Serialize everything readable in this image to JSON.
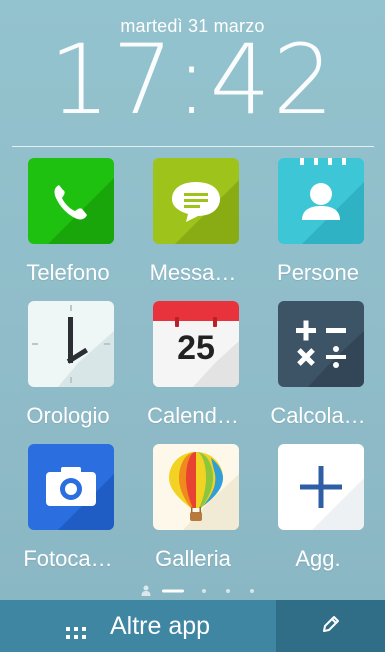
{
  "lockscreen": {
    "date": "martedì 31 marzo",
    "time": "17:42"
  },
  "apps": [
    {
      "label": "Telefono",
      "icon": "phone-icon",
      "color": "#1ec10f"
    },
    {
      "label": "Messa…",
      "icon": "message-icon",
      "color": "#9ec31b"
    },
    {
      "label": "Persone",
      "icon": "contact-icon",
      "color": "#3cc6d6"
    },
    {
      "label": "Orologio",
      "icon": "clock-icon",
      "color": "#eef6f6"
    },
    {
      "label": "Calend…",
      "icon": "calendar-icon",
      "color": "#e8323c",
      "calendar_day": "25"
    },
    {
      "label": "Calcola…",
      "icon": "calculator-icon",
      "color": "#3d5366"
    },
    {
      "label": "Fotoca…",
      "icon": "camera-icon",
      "color": "#2a6ee0"
    },
    {
      "label": "Galleria",
      "icon": "balloon-icon",
      "color": "#fdf8e9"
    },
    {
      "label": "Agg.",
      "icon": "plus-icon",
      "color": "#ffffff"
    }
  ],
  "page_indicator": {
    "pages": 4,
    "current": 1
  },
  "bottom_bar": {
    "all_apps_label": "Altre app",
    "all_apps_icon": "grid-dots-icon",
    "edit_icon": "pencil-icon"
  }
}
